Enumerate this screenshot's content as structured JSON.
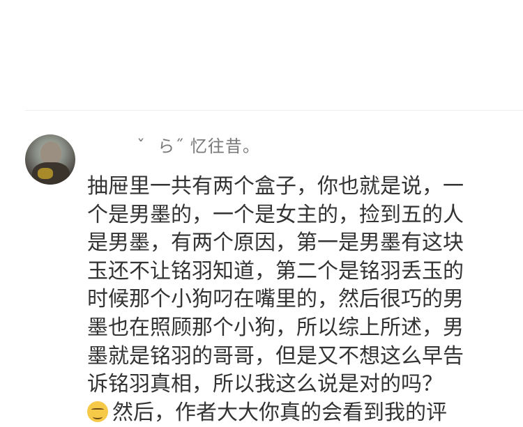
{
  "comment": {
    "username": "ˇ  ら˝ 忆往昔。",
    "lines": [
      "抽屉里一共有两个盒子，你也就是说，一",
      "个是男墨的，一个是女主的，捡到五的人",
      "是男墨，有两个原因，第一是男墨有这块",
      "玉还不让铭羽知道，第二个是铭羽丢玉的",
      "时候那个小狗叼在嘴里的，然后很巧的男",
      "墨也在照顾那个小狗，所以综上所述，男",
      "墨就是铭羽的哥哥，但是又不想这么早告",
      "诉铭羽真相，所以我这么说是对的吗？",
      "然后，作者大大你真的会看到我的评"
    ],
    "emoji": "smirk-emoji"
  }
}
